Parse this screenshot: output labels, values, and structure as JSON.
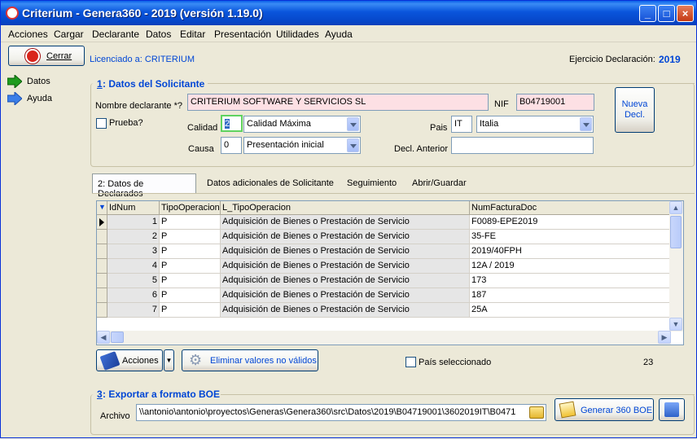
{
  "window": {
    "title": "Criterium - Genera360 - 2019 (versión 1.19.0)"
  },
  "menu": [
    "Acciones",
    "Cargar",
    "Declarante",
    "Datos",
    "Editar",
    "Presentación",
    "Utilidades",
    "Ayuda"
  ],
  "toolbar": {
    "close_label": "Cerrar",
    "license_text": "Licenciado a: CRITERIUM",
    "ejercicio_label": "Ejercicio Declaración:",
    "ejercicio_value": "2019"
  },
  "nav": [
    {
      "label": "Datos"
    },
    {
      "label": "Ayuda"
    }
  ],
  "solicitante": {
    "section_num": "1",
    "section_title": ": Datos del Solicitante",
    "nombre_label": "Nombre declarante *?",
    "nombre_value": "CRITERIUM SOFTWARE Y SERVICIOS SL",
    "nif_label": "NIF",
    "nif_value": "B04719001",
    "nueva_decl_label": "Nueva Decl.",
    "prueba_label": "Prueba?",
    "calidad_label": "Calidad",
    "calidad_code": "2",
    "calidad_value": "Calidad Máxima",
    "pais_label": "Pais",
    "pais_code": "IT",
    "pais_value": "Italia",
    "causa_label": "Causa",
    "causa_code": "0",
    "causa_value": "Presentación inicial",
    "decl_anterior_label": "Decl. Anterior",
    "decl_anterior_value": ""
  },
  "tabs": [
    {
      "label": "2: Datos de Declarados"
    },
    {
      "label": "Datos adicionales de Solicitante"
    },
    {
      "label": "Seguimiento"
    },
    {
      "label": "Abrir/Guardar"
    }
  ],
  "grid": {
    "columns": [
      "IdNum",
      "TipoOperacion",
      "L_TipoOperacion",
      "NumFacturaDoc"
    ],
    "rows": [
      [
        "1",
        "P",
        "Adquisición de Bienes o Prestación de Servicio",
        "F0089-EPE2019"
      ],
      [
        "2",
        "P",
        "Adquisición de Bienes o Prestación de Servicio",
        "35-FE"
      ],
      [
        "3",
        "P",
        "Adquisición de Bienes o Prestación de Servicio",
        "2019/40FPH"
      ],
      [
        "4",
        "P",
        "Adquisición de Bienes o Prestación de Servicio",
        "12A / 2019"
      ],
      [
        "5",
        "P",
        "Adquisición de Bienes o Prestación de Servicio",
        "173"
      ],
      [
        "6",
        "P",
        "Adquisición de Bienes o Prestación de Servicio",
        "187"
      ],
      [
        "7",
        "P",
        "Adquisición de Bienes o Prestación de Servicio",
        "25A"
      ]
    ]
  },
  "actions": {
    "acciones_label": "Acciones",
    "eliminar_label": "Eliminar valores no válidos",
    "pais_sel_label": "País seleccionado",
    "count": "23"
  },
  "export": {
    "section_num": "3",
    "section_title": ": Exportar a formato BOE",
    "archivo_label": "Archivo",
    "archivo_value": "\\\\antonio\\antonio\\proyectos\\Generas\\Genera360\\src\\Datos\\2019\\B04719001\\3602019IT\\B0471",
    "generar_label": "Generar 360 BOE"
  }
}
